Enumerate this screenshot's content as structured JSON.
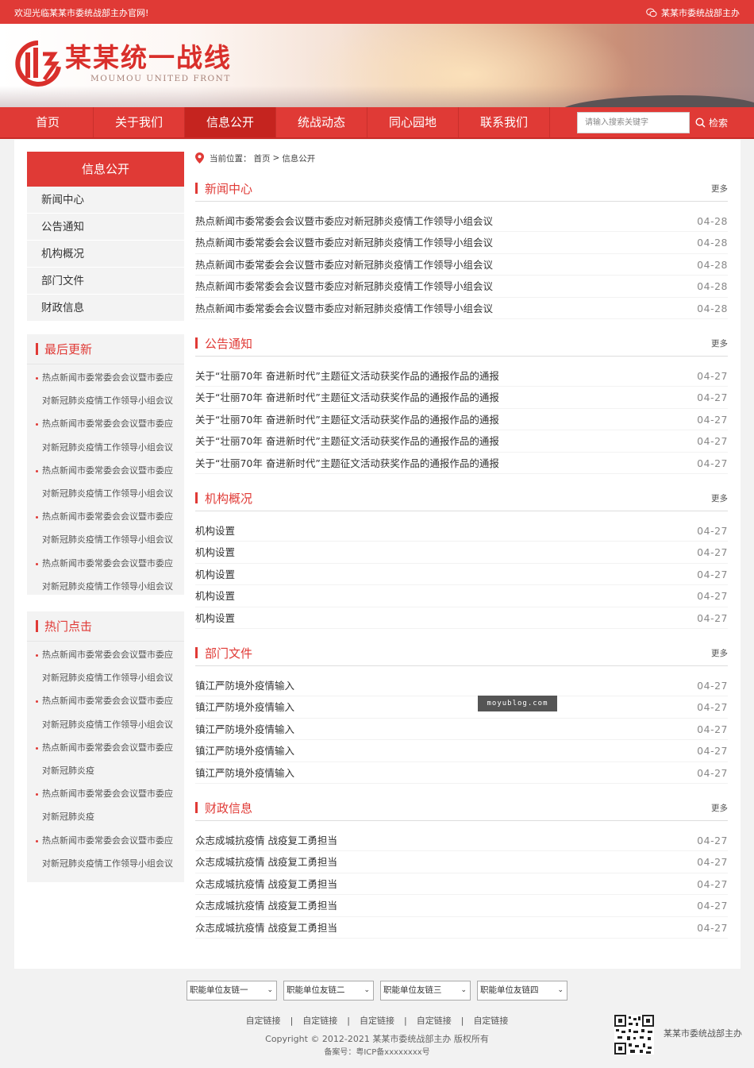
{
  "topbar": {
    "welcome": "欢迎光临某某市委统战部主办官网!",
    "org_link": "某某市委统战部主办"
  },
  "header": {
    "logo_title": "某某统一战线",
    "logo_subtitle": "MOUMOU UNITED FRONT"
  },
  "nav": {
    "items": [
      "首页",
      "关于我们",
      "信息公开",
      "统战动态",
      "同心园地",
      "联系我们"
    ],
    "active_index": 2,
    "search_placeholder": "请输入搜索关键字",
    "search_button": "检索"
  },
  "sidebar": {
    "heading": "信息公开",
    "menu": [
      "新闻中心",
      "公告通知",
      "机构概况",
      "部门文件",
      "财政信息"
    ],
    "latest": {
      "title": "最后更新",
      "items": [
        "热点新闻市委常委会会议暨市委应",
        "对新冠肺炎疫情工作领导小组会议",
        "热点新闻市委常委会会议暨市委应",
        "对新冠肺炎疫情工作领导小组会议",
        "热点新闻市委常委会会议暨市委应",
        "对新冠肺炎疫情工作领导小组会议",
        "热点新闻市委常委会会议暨市委应",
        "对新冠肺炎疫情工作领导小组会议",
        "热点新闻市委常委会会议暨市委应",
        "对新冠肺炎疫情工作领导小组会议"
      ]
    },
    "hot": {
      "title": "热门点击",
      "items": [
        "热点新闻市委常委会会议暨市委应",
        "对新冠肺炎疫情工作领导小组会议",
        "热点新闻市委常委会会议暨市委应",
        "对新冠肺炎疫情工作领导小组会议",
        "热点新闻市委常委会会议暨市委应",
        "对新冠肺炎疫",
        "热点新闻市委常委会会议暨市委应",
        "对新冠肺炎疫",
        "热点新闻市委常委会会议暨市委应",
        "对新冠肺炎疫情工作领导小组会议"
      ]
    }
  },
  "breadcrumb": {
    "prefix": "当前位置：",
    "home": "首页",
    "separator": ">",
    "current": "信息公开"
  },
  "sections": [
    {
      "title": "新闻中心",
      "more": "更多",
      "rows": [
        {
          "text": "热点新闻市委常委会会议暨市委应对新冠肺炎疫情工作领导小组会议",
          "date": "04-28"
        },
        {
          "text": "热点新闻市委常委会会议暨市委应对新冠肺炎疫情工作领导小组会议",
          "date": "04-28"
        },
        {
          "text": "热点新闻市委常委会会议暨市委应对新冠肺炎疫情工作领导小组会议",
          "date": "04-28"
        },
        {
          "text": "热点新闻市委常委会会议暨市委应对新冠肺炎疫情工作领导小组会议",
          "date": "04-28"
        },
        {
          "text": "热点新闻市委常委会会议暨市委应对新冠肺炎疫情工作领导小组会议",
          "date": "04-28"
        }
      ]
    },
    {
      "title": "公告通知",
      "more": "更多",
      "rows": [
        {
          "text": "关于“壮丽70年 奋进新时代”主题征文活动获奖作品的通报作品的通报",
          "date": "04-27"
        },
        {
          "text": "关于“壮丽70年 奋进新时代”主题征文活动获奖作品的通报作品的通报",
          "date": "04-27"
        },
        {
          "text": "关于“壮丽70年 奋进新时代”主题征文活动获奖作品的通报作品的通报",
          "date": "04-27"
        },
        {
          "text": "关于“壮丽70年 奋进新时代”主题征文活动获奖作品的通报作品的通报",
          "date": "04-27"
        },
        {
          "text": "关于“壮丽70年 奋进新时代”主题征文活动获奖作品的通报作品的通报",
          "date": "04-27"
        }
      ]
    },
    {
      "title": "机构概况",
      "more": "更多",
      "rows": [
        {
          "text": "机构设置",
          "date": "04-27"
        },
        {
          "text": "机构设置",
          "date": "04-27"
        },
        {
          "text": "机构设置",
          "date": "04-27"
        },
        {
          "text": "机构设置",
          "date": "04-27"
        },
        {
          "text": "机构设置",
          "date": "04-27"
        }
      ]
    },
    {
      "title": "部门文件",
      "more": "更多",
      "rows": [
        {
          "text": "镇江严防境外疫情输入",
          "date": "04-27"
        },
        {
          "text": "镇江严防境外疫情输入",
          "date": "04-27"
        },
        {
          "text": "镇江严防境外疫情输入",
          "date": "04-27"
        },
        {
          "text": "镇江严防境外疫情输入",
          "date": "04-27"
        },
        {
          "text": "镇江严防境外疫情输入",
          "date": "04-27"
        }
      ]
    },
    {
      "title": "财政信息",
      "more": "更多",
      "rows": [
        {
          "text": "众志成城抗疫情 战疫复工勇担当",
          "date": "04-27"
        },
        {
          "text": "众志成城抗疫情 战疫复工勇担当",
          "date": "04-27"
        },
        {
          "text": "众志成城抗疫情 战疫复工勇担当",
          "date": "04-27"
        },
        {
          "text": "众志成城抗疫情 战疫复工勇担当",
          "date": "04-27"
        },
        {
          "text": "众志成城抗疫情 战疫复工勇担当",
          "date": "04-27"
        }
      ]
    }
  ],
  "watermark": "moyublog.com",
  "footer": {
    "selects": [
      "职能单位友链一",
      "职能单位友链二",
      "职能单位友链三",
      "职能单位友链四"
    ],
    "links": [
      "自定链接",
      "自定链接",
      "自定链接",
      "自定链接",
      "自定链接"
    ],
    "link_separator": "|",
    "copyright": "Copyright © 2012-2021 某某市委统战部主办 版权所有",
    "icp": "备案号：粤ICP备xxxxxxxx号",
    "qr_label": "某某市委统战部主办"
  },
  "colors": {
    "brand_red": "#e03a36",
    "nav_active": "#c5241f"
  }
}
